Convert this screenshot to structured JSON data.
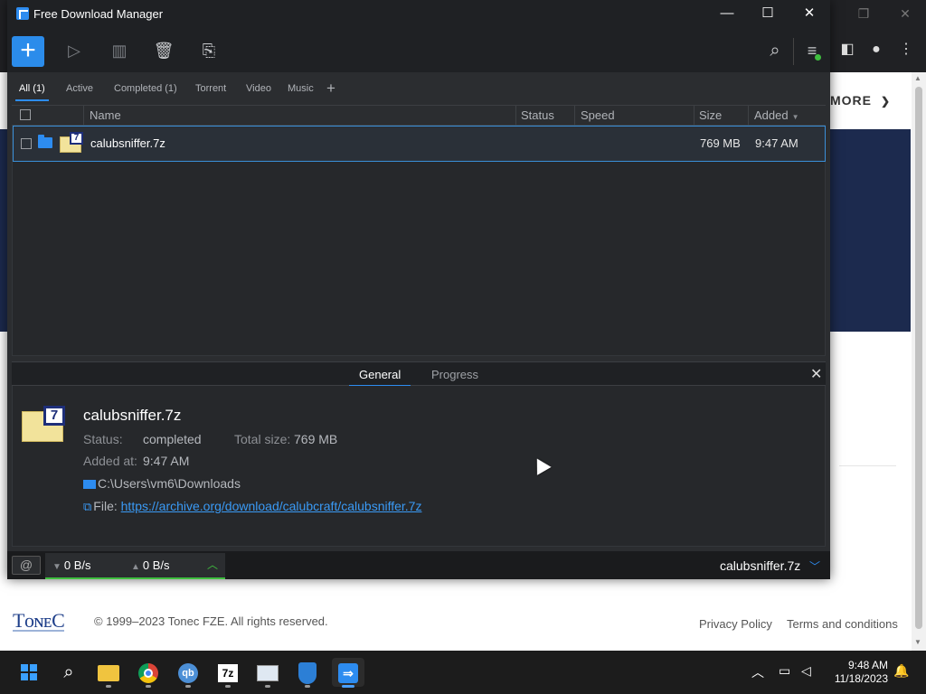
{
  "window": {
    "title": "Free Download Manager"
  },
  "toolbar": {
    "add_label": "+",
    "buttons": [
      "play-icon",
      "pause-icon",
      "trash-icon",
      "move-folder-icon",
      "search-icon",
      "menu-icon"
    ]
  },
  "tabs": [
    {
      "label": "All (1)",
      "active": true
    },
    {
      "label": "Active"
    },
    {
      "label": "Completed (1)"
    },
    {
      "label": "Torrent"
    },
    {
      "label": "Video"
    },
    {
      "label": "Music"
    }
  ],
  "tab_add": "+",
  "columns": {
    "name": "Name",
    "status": "Status",
    "speed": "Speed",
    "size": "Size",
    "added": "Added"
  },
  "downloads": [
    {
      "name": "calubsniffer.7z",
      "status": "",
      "speed": "",
      "size": "769 MB",
      "added": "9:47 AM",
      "icon": "7z"
    }
  ],
  "details": {
    "tabs": {
      "general": "General",
      "progress": "Progress"
    },
    "file_name": "calubsniffer.7z",
    "status_label": "Status:",
    "status_value": "completed",
    "total_size_label": "Total size:",
    "total_size_value": "769 MB",
    "added_label": "Added at:",
    "added_value": "9:47 AM",
    "path": "C:\\Users\\vm6\\Downloads",
    "file_label": "File:",
    "file_url": "https://archive.org/download/calubcraft/calubsniffer.7z"
  },
  "statusbar": {
    "download_speed": "0 B/s",
    "upload_speed": "0 B/s",
    "current_file": "calubsniffer.7z"
  },
  "background_page": {
    "more_label": "MORE",
    "logo": "TᴏɴᴇC",
    "copyright": "© 1999–2023 Tonec FZE. All rights reserved.",
    "privacy": "Privacy Policy",
    "terms": "Terms and conditions"
  },
  "taskbar": {
    "apps": [
      "start-icon",
      "search-icon",
      "file-explorer-icon",
      "chrome-icon",
      "qbittorrent-icon",
      "7zip-icon",
      "monitor-app-icon",
      "defender-icon",
      "fdm-icon"
    ],
    "time": "9:48 AM",
    "date": "11/18/2023"
  },
  "colors": {
    "accent": "#2d8cf0",
    "window_bg": "#2b2d30",
    "navy_banner": "#1c2a4e",
    "green": "#3fbf3f"
  }
}
